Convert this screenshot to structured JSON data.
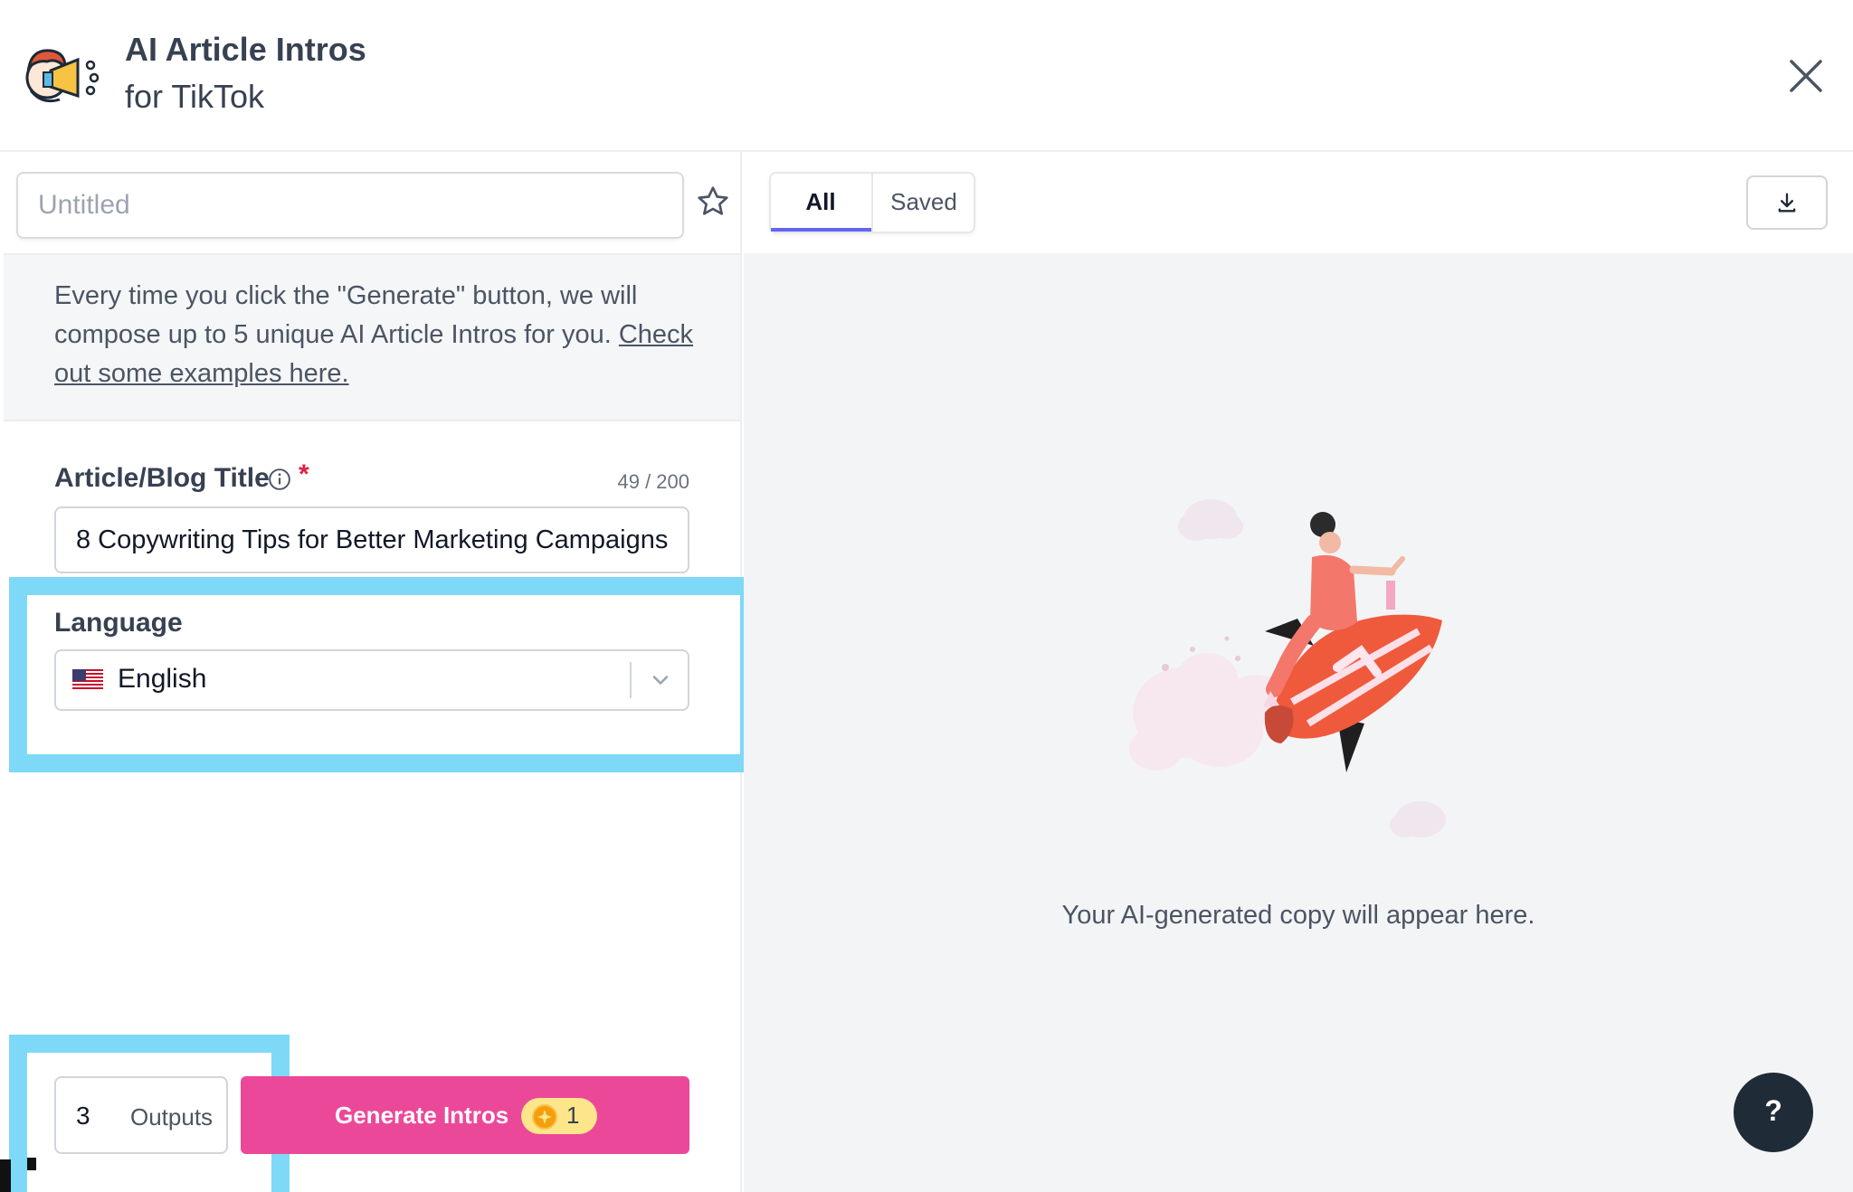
{
  "header": {
    "title": "AI Article Intros",
    "subtitle": "for TikTok",
    "logo_icon": "megaphone-character-icon",
    "close_icon": "close-icon"
  },
  "document": {
    "title_placeholder": "Untitled",
    "title_value": "",
    "favorite_icon": "star-outline-icon"
  },
  "info": {
    "text": "Every time you click the \"Generate\" button, we will compose up to 5 unique AI Article Intros for you.",
    "link_text": "Check out some examples here."
  },
  "form": {
    "blog_title": {
      "label": "Article/Blog Title",
      "required_mark": "*",
      "char_count": "49 / 200",
      "value": "8 Copywriting Tips for Better Marketing Campaigns"
    },
    "language": {
      "label": "Language",
      "selected": "English",
      "flag_icon": "us-flag-icon"
    }
  },
  "actions": {
    "outputs_value": "3",
    "outputs_label": "Outputs",
    "generate_label": "Generate Intros",
    "credit_cost": "1"
  },
  "results": {
    "tabs": [
      {
        "label": "All",
        "active": true
      },
      {
        "label": "Saved",
        "active": false
      }
    ],
    "download_icon": "download-icon",
    "empty_message": "Your AI-generated copy will appear here."
  },
  "help": {
    "label": "?"
  },
  "colors": {
    "accent_pink": "#ec4899",
    "tab_indicator": "#6366f1",
    "highlight": "#7dd9f7",
    "help_button": "#1f2b37"
  }
}
